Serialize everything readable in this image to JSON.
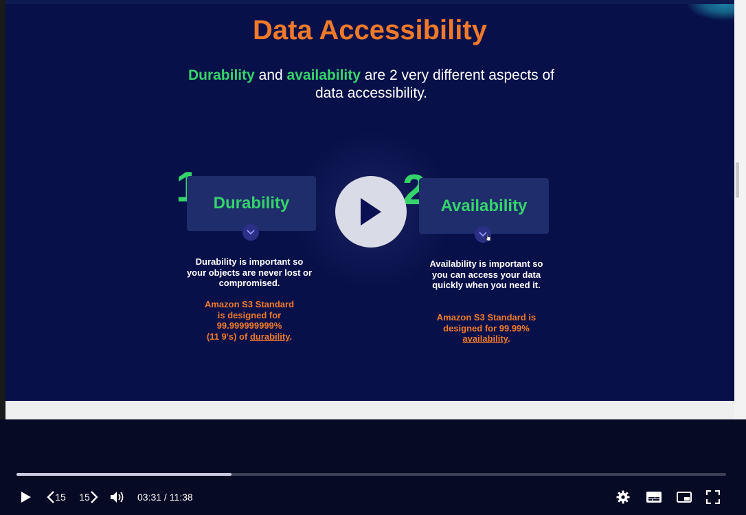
{
  "slide": {
    "title": "Data Accessibility",
    "subtitle_part1": "Durability",
    "subtitle_part2": " and ",
    "subtitle_part3": "availability",
    "subtitle_part4": " are 2 very different aspects of data accessibility.",
    "items": [
      {
        "number": "1",
        "heading": "Durability",
        "description": "Durability is important so your objects are never lost or compromised.",
        "note_lines": [
          "Amazon S3 Standard",
          "is designed for",
          "99.999999999%"
        ],
        "note_last_prefix": "(11 9's) of ",
        "note_link": "durability",
        "note_suffix": "."
      },
      {
        "number": "2",
        "heading": "Availability",
        "description": "Availability is important so you can access your data quickly when you need it.",
        "note_lines": [
          "Amazon S3 Standard is",
          "designed for 99.99%"
        ],
        "note_last_prefix": "",
        "note_link": "availability",
        "note_suffix": "."
      }
    ]
  },
  "player": {
    "progress_fraction": 0.303,
    "rewind_seconds": "15",
    "forward_seconds": "15",
    "current_time": "03:31",
    "time_separator": " / ",
    "duration": "11:38",
    "icons": [
      "play-icon",
      "rewind-icon",
      "forward-icon",
      "volume-icon",
      "settings-icon",
      "captions-icon",
      "picture-in-picture-icon",
      "fullscreen-icon"
    ]
  },
  "colors": {
    "title": "#f07a2a",
    "highlight": "#35d46a",
    "slide_bg": "#08104a",
    "player_bg": "#070a24"
  }
}
